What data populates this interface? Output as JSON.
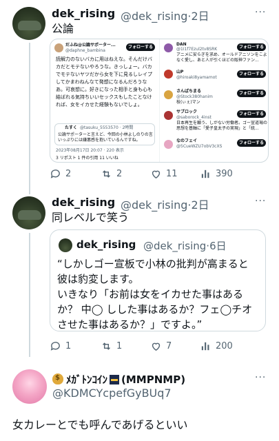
{
  "tweet1": {
    "name": "dek_rising",
    "handle": "@dek_rising",
    "sep": "·",
    "time": "2日",
    "text": "公論",
    "replies": "2",
    "retweets": "2",
    "likes": "11",
    "views": "390"
  },
  "embed": {
    "author_name": "だふね@公論サポーター...",
    "author_handle": "@daphne_bambina",
    "follow_label": "フォローする",
    "body": "読解力のないバカに用はねえな。そんだけバカだとモテないやろうな。きっしょー。バカでモテないヤツだから女を下に見るしレイプしてかまわねんなて発想になるんだろうなあ。可哀想に。好きになった相手と身も心も結ばれる気持ちいいセックスもしたことなければ、女をイカせた経験もないでしょ。",
    "quoted_name": "たすく",
    "quoted_handle": "@tasuku_5553570 · 2時間",
    "quoted_text": "公論サポーターと言えど、今回の小林よしのりの言いっぷりには嫌悪感を抱いているんですね。",
    "timestamp": "2023年08月17日 20:07 · 220 表示",
    "stats": "3 リポスト   1 件の引用   11 いいね",
    "suggestions": [
      {
        "name": "DAN",
        "handle": "@1I1f7Ezul2tv8SRK",
        "bio": "アニメに安らぎを求め、オールドアニソンをこよなく愛し、あと人が引くほどの阪神ファン..."
      },
      {
        "name": "山P",
        "handle": "@hiroaki8yamamot",
        "bio": ""
      },
      {
        "name": "さんばちまる",
        "handle": "@Stock380hanim",
        "bio": "枝(ぃぇ)マン"
      },
      {
        "name": "サブロック",
        "handle": "@saborock_4inst",
        "bio": "日本再生を願う、しがない労働者。ゴー宣道場の思想を基軸に「愛子皇太子の実現」と「統..."
      },
      {
        "name": "なのフェイ",
        "handle": "@5CueWZU7obV3cXS",
        "bio": ""
      }
    ]
  },
  "tweet2": {
    "name": "dek_rising",
    "handle": "@dek_rising",
    "sep": "·",
    "time": "2日",
    "text": "同レベルで笑う",
    "quote_name": "dek_rising",
    "quote_handle": "@dek_rising",
    "quote_time": "6日",
    "quote_lines": [
      "“しかしゴー宣板で小林の批判が高まると",
      "彼は豹変します。",
      "いきなり「お前は女をイカせた事はある",
      "か？ 中◯ しした事はあるか？フェ◯チオ",
      "させた事はあるか？」ですよ。”"
    ],
    "replies": "1",
    "retweets": "1",
    "likes": "7",
    "views": "200"
  },
  "tweet3": {
    "name_prefix": "ﾒｶﾞﾄﾝｺｲﾝ",
    "name_suffix": "(MMPNMP)",
    "handle": "@KDMCYcpefGyBUq7",
    "text": "女カレーとでも呼んであげるといい"
  },
  "colors": {
    "accent": "#1d9bf0",
    "muted": "#536471",
    "border": "#cfd9de"
  }
}
